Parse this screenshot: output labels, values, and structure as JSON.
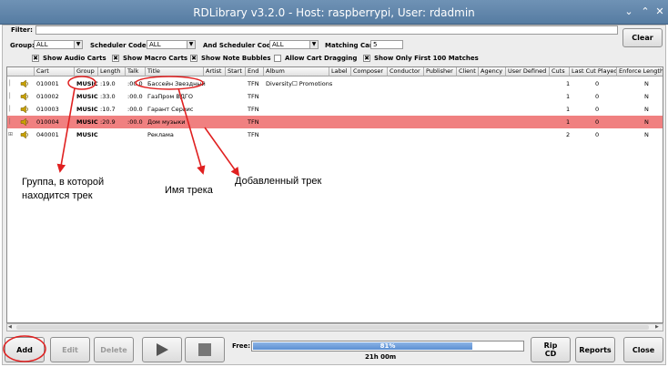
{
  "window": {
    "title": "RDLibrary v3.2.0 - Host: raspberrypi, User: rdadmin"
  },
  "filter": {
    "label": "Filter:",
    "value": "",
    "clear_label": "Clear"
  },
  "group": {
    "label": "Group:",
    "value": "ALL"
  },
  "scheduler_code": {
    "label": "Scheduler Code:",
    "value": "ALL"
  },
  "and_scheduler_code": {
    "label": "And Scheduler Code:",
    "value": "ALL"
  },
  "matching_carts": {
    "label": "Matching Carts:",
    "value": "5"
  },
  "checkboxes": [
    {
      "label": "Show Audio Carts",
      "checked": true
    },
    {
      "label": "Show Macro Carts",
      "checked": true
    },
    {
      "label": "Show Note Bubbles",
      "checked": true
    },
    {
      "label": "Allow Cart Dragging",
      "checked": false
    },
    {
      "label": "Show Only First 100 Matches",
      "checked": true
    }
  ],
  "table": {
    "columns": [
      "",
      "Cart",
      "Group",
      "Length",
      "Talk",
      "Title",
      "Artist",
      "Start",
      "End",
      "Album",
      "Label",
      "Composer",
      "Conductor",
      "Publisher",
      "Client",
      "Agency",
      "User Defined",
      "Cuts",
      "Last Cut Played",
      "Enforce Length"
    ],
    "rows": [
      {
        "cart": "010001",
        "group": "MUSIC",
        "length": ":19.0",
        "talk": ":00.0",
        "title": "Бассейн Звездный",
        "end": "TFN",
        "album": "Diversity☐ Promotions",
        "cuts": "1",
        "last_played": "0",
        "enforce": "N",
        "selected": false
      },
      {
        "cart": "010002",
        "group": "MUSIC",
        "length": ":33.0",
        "talk": ":00.0",
        "title": "ГазПром ВДГО",
        "end": "TFN",
        "album": "",
        "cuts": "1",
        "last_played": "0",
        "enforce": "N",
        "selected": false
      },
      {
        "cart": "010003",
        "group": "MUSIC",
        "length": ":10.7",
        "talk": ":00.0",
        "title": "Гарант Сервис",
        "end": "TFN",
        "album": "",
        "cuts": "1",
        "last_played": "0",
        "enforce": "N",
        "selected": false
      },
      {
        "cart": "010004",
        "group": "MUSIC",
        "length": ":20.9",
        "talk": ":00.0",
        "title": "Дом музыки",
        "end": "TFN",
        "album": "",
        "cuts": "1",
        "last_played": "0",
        "enforce": "N",
        "selected": true
      },
      {
        "cart": "040001",
        "group": "MUSIC",
        "length": "",
        "talk": "",
        "title": "Реклама",
        "end": "TFN",
        "album": "",
        "cuts": "2",
        "last_played": "0",
        "enforce": "N",
        "selected": false
      }
    ]
  },
  "annotations": {
    "group_note": "Группа, в которой\nнаходится трек",
    "title_note": "Имя трека",
    "added_note": "Добавленный трек"
  },
  "bottom": {
    "add_label": "Add",
    "edit_label": "Edit",
    "delete_label": "Delete",
    "free_label": "Free:",
    "free_percent": 81,
    "free_percent_text": "81%",
    "free_time": "21h 00m",
    "rip_label": "Rip\nCD",
    "reports_label": "Reports",
    "close_label": "Close"
  },
  "colors": {
    "selected_row": "#f08080",
    "annotation": "#e02020",
    "titlebar": "#6188ae"
  }
}
